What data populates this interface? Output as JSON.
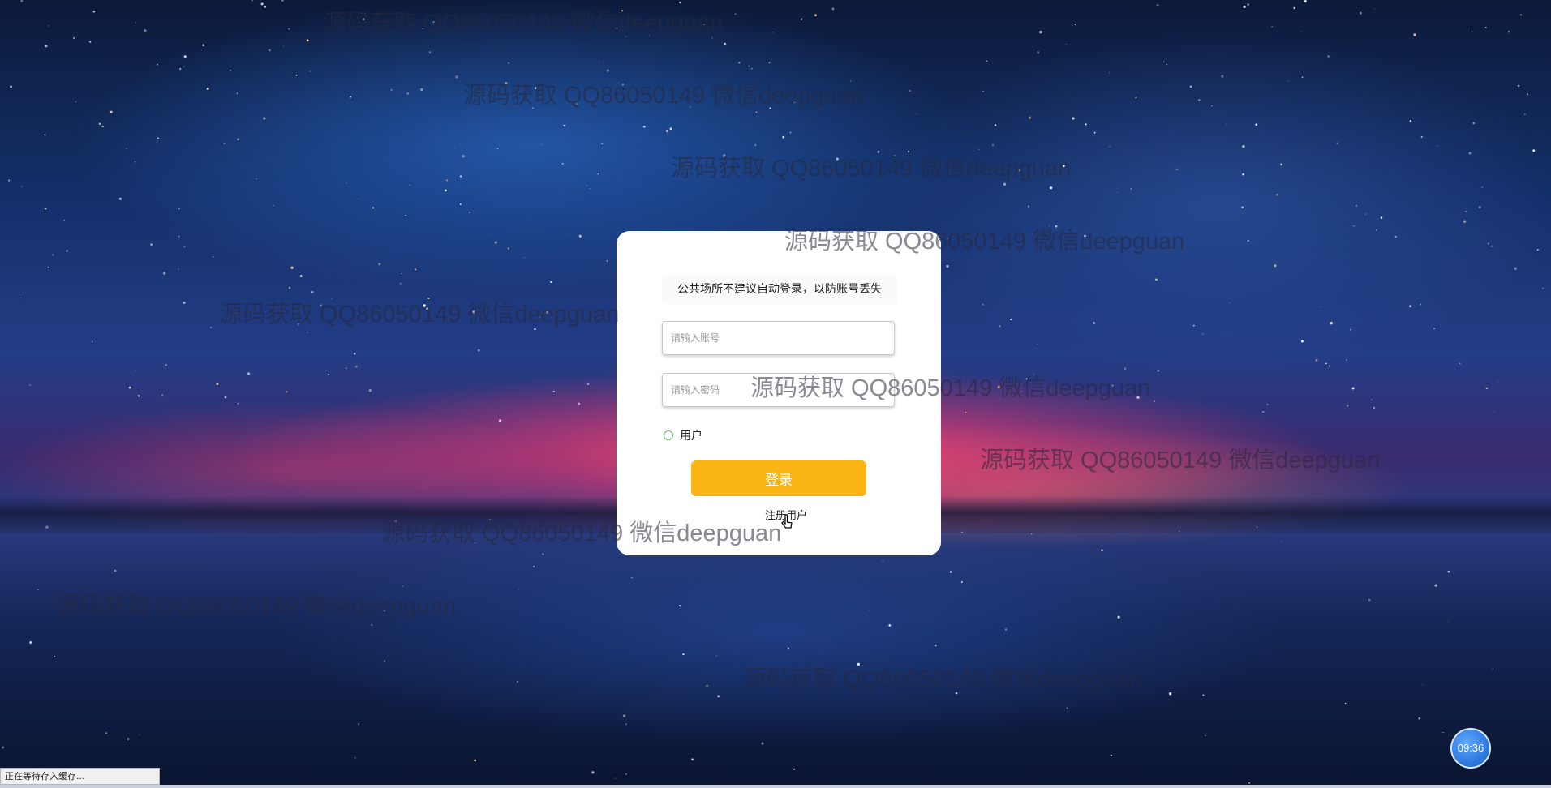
{
  "login": {
    "notice": "公共场所不建议自动登录，以防账号丢失",
    "account_placeholder": "请输入账号",
    "password_placeholder": "请输入密码",
    "role_label": "用户",
    "login_button": "登录",
    "register_link": "注册用户"
  },
  "watermark_text": "源码获取 QQ86050149 微信deepguan",
  "clock": {
    "time": "09:36"
  },
  "status_bar": {
    "text": "正在等待存入缓存..."
  },
  "colors": {
    "login_button": "#fbb615",
    "radio_border": "#5cb85c",
    "card": "#ffffff",
    "clock": "#2f7be0"
  }
}
